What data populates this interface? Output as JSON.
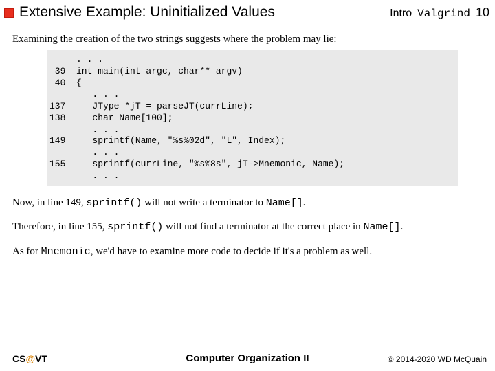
{
  "header": {
    "title": "Extensive Example:  Uninitialized Values",
    "intro": "Intro",
    "tool": "Valgrind",
    "page": "10"
  },
  "body": {
    "lead": "Examining the creation of the two strings suggests where the problem may lie:",
    "code": "     . . .\n 39  int main(int argc, char** argv)\n 40  {\n        . . .\n137     JType *jT = parseJT(currLine);\n138     char Name[100];\n        . . .\n149     sprintf(Name, \"%s%02d\", \"L\", Index);\n        . . .\n155     sprintf(currLine, \"%s%8s\", jT->Mnemonic, Name);\n        . . .",
    "p1a": "Now, in line 149, ",
    "p1b": "sprintf()",
    "p1c": " will not write a terminator to ",
    "p1d": "Name[]",
    "p1e": ".",
    "p2a": "Therefore, in line 155, ",
    "p2b": "sprintf()",
    "p2c": " will not find a terminator at the correct place in ",
    "p2d": "Name[]",
    "p2e": ".",
    "p3a": "As for ",
    "p3b": "Mnemonic",
    "p3c": ", we'd have to examine more code to decide if it's a problem as well."
  },
  "footer": {
    "left_a": "CS",
    "left_b": "@",
    "left_c": "VT",
    "center": "Computer Organization II",
    "right": "© 2014-2020 WD McQuain"
  }
}
